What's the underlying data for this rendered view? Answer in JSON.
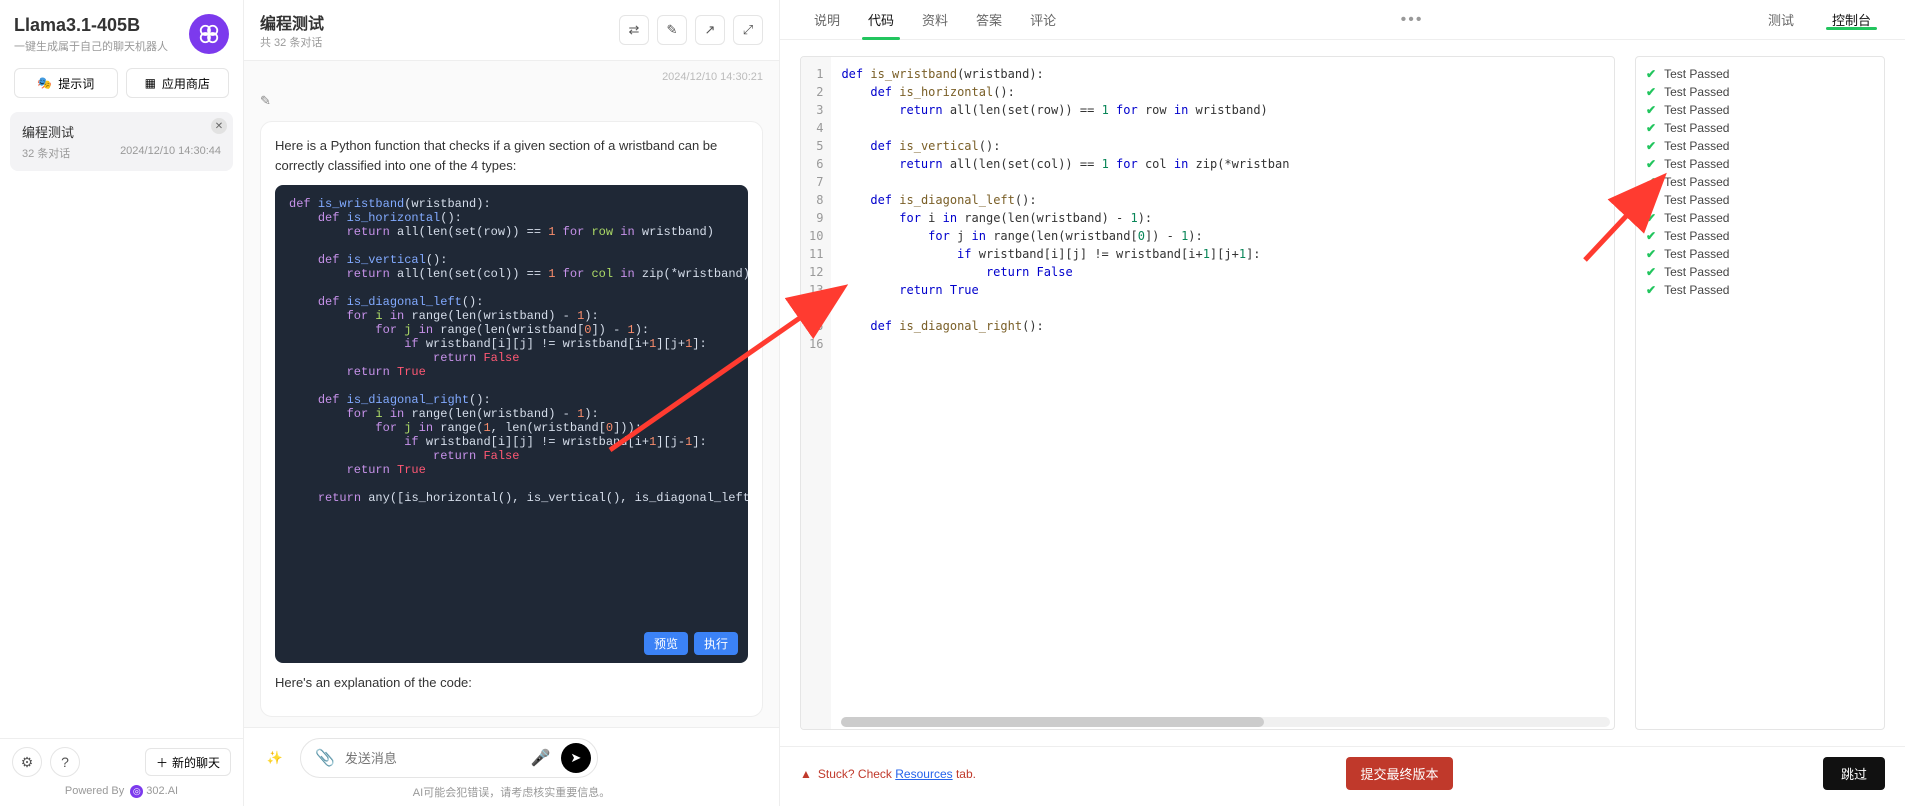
{
  "sidebar": {
    "model_name": "Llama3.1-405B",
    "model_sub": "一键生成属于自己的聊天机器人",
    "btn_prompt": "提示词",
    "btn_store": "应用商店",
    "conv": {
      "title": "编程测试",
      "count": "32 条对话",
      "time": "2024/12/10 14:30:44"
    },
    "new_chat": "新的聊天",
    "powered_prefix": "Powered By",
    "powered_brand": "302.AI"
  },
  "chat": {
    "title": "编程测试",
    "sub": "共 32 条对话",
    "top_time": "2024/12/10 14:30:21",
    "assistant_intro": "Here is a Python function that checks if a given section of a wristband can be correctly classified into one of the 4 types:",
    "btn_preview": "预览",
    "btn_run": "执行",
    "assistant_after": "Here's an explanation of the code:",
    "input_placeholder": "发送消息",
    "disclaimer": "AI可能会犯错误，请考虑核实重要信息。"
  },
  "code_dark": {
    "l1a": "def",
    "l1b": "is_wristband",
    "l1c": "(wristband):",
    "l2a": "def",
    "l2b": "is_horizontal",
    "l2c": "():",
    "l3a": "return",
    "l3b": "all(len(set(row)) ==",
    "l3c": "1",
    "l3d": "for",
    "l3e": "row",
    "l3f": "in",
    "l3g": "wristband)",
    "l4a": "def",
    "l4b": "is_vertical",
    "l4c": "():",
    "l5a": "return",
    "l5b": "all(len(set(col)) ==",
    "l5c": "1",
    "l5d": "for",
    "l5e": "col",
    "l5f": "in",
    "l5g": "zip(*wristband))",
    "l6a": "def",
    "l6b": "is_diagonal_left",
    "l6c": "():",
    "l7a": "for",
    "l7b": "i",
    "l7c": "in",
    "l7d": "range(len(wristband) -",
    "l7e": "1",
    "l7f": "):",
    "l8a": "for",
    "l8b": "j",
    "l8c": "in",
    "l8d": "range(len(wristband[",
    "l8e": "0",
    "l8f": "]) -",
    "l8g": "1",
    "l8h": "):",
    "l9a": "if",
    "l9b": "wristband[i][j] != wristband[i+",
    "l9c": "1",
    "l9d": "][j+",
    "l9e": "1",
    "l9f": "]:",
    "l10a": "return",
    "l10b": "False",
    "l11a": "return",
    "l11b": "True",
    "l12a": "def",
    "l12b": "is_diagonal_right",
    "l12c": "():",
    "l13a": "for",
    "l13b": "i",
    "l13c": "in",
    "l13d": "range(len(wristband) -",
    "l13e": "1",
    "l13f": "):",
    "l14a": "for",
    "l14b": "j",
    "l14c": "in",
    "l14d": "range(",
    "l14e": "1",
    "l14f": ", len(wristband[",
    "l14g": "0",
    "l14h": "])):",
    "l15a": "if",
    "l15b": "wristband[i][j] != wristband[i+",
    "l15c": "1",
    "l15d": "][j-",
    "l15e": "1",
    "l15f": "]:",
    "l16a": "return",
    "l16b": "False",
    "l17a": "return",
    "l17b": "True",
    "l18a": "return",
    "l18b": "any([is_horizontal(), is_vertical(), is_diagonal_left(),"
  },
  "editor": {
    "lines": [
      "1",
      "2",
      "3",
      "4",
      "5",
      "6",
      "7",
      "8",
      "9",
      "10",
      "11",
      "12",
      "13",
      "14",
      "15",
      "16"
    ]
  },
  "ed_code": {
    "l1": "def is_wristband(wristband):",
    "l2": "    def is_horizontal():",
    "l3": "        return all(len(set(row)) == 1 for row in wristband)",
    "l4": "",
    "l5": "    def is_vertical():",
    "l6": "        return all(len(set(col)) == 1 for col in zip(*wristban",
    "l7": "",
    "l8": "    def is_diagonal_left():",
    "l9": "        for i in range(len(wristband) - 1):",
    "l10": "            for j in range(len(wristband[0]) - 1):",
    "l11": "                if wristband[i][j] != wristband[i+1][j+1]:",
    "l12": "                    return False",
    "l13": "        return True",
    "l14": "",
    "l15": "    def is_diagonal_right():",
    "l16": ""
  },
  "right_tabs": {
    "t1": "说明",
    "t2": "代码",
    "t3": "资料",
    "t4": "答案",
    "t5": "评论",
    "r1": "测试",
    "r2": "控制台"
  },
  "tests": {
    "label": "Test Passed"
  },
  "foot": {
    "stuck_pre": "Stuck? Check ",
    "stuck_link": "Resources",
    "stuck_post": " tab.",
    "submit": "提交最终版本",
    "skip": "跳过"
  }
}
